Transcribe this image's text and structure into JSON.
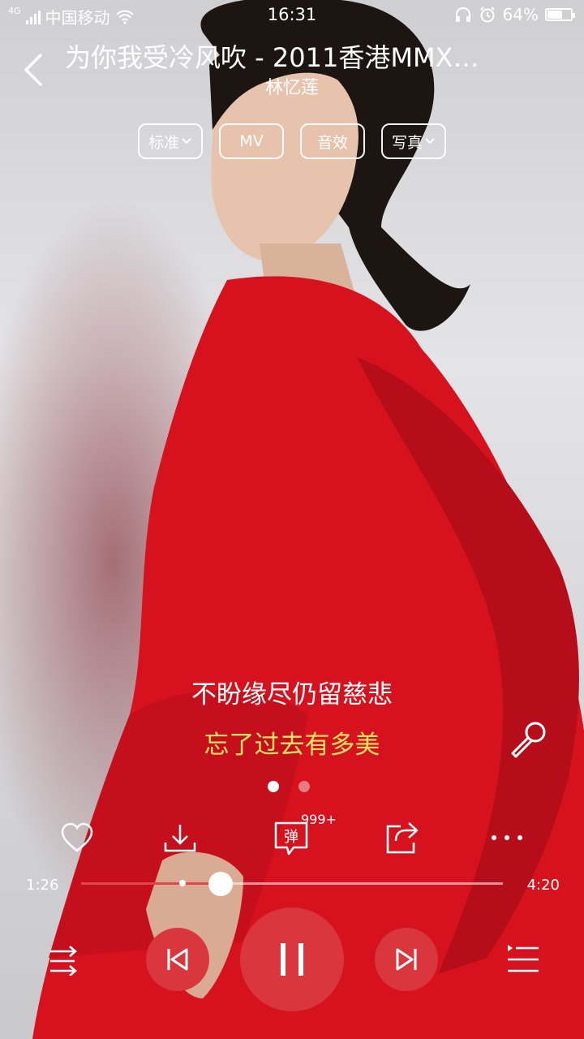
{
  "status_bar": {
    "network": "4G",
    "carrier": "中国移动",
    "time": "16:31",
    "battery_text": "64%",
    "battery_level": 0.64
  },
  "header": {
    "title": "为你我受冷风吹 - 2011香港MMX…",
    "artist": "林忆莲"
  },
  "pills": [
    {
      "label": "标准",
      "dropdown": true
    },
    {
      "label": "MV",
      "dropdown": false
    },
    {
      "label": "音效",
      "dropdown": false
    },
    {
      "label": "写真",
      "dropdown": true
    }
  ],
  "lyrics": {
    "previous_line": "不盼缘尽仍留慈悲",
    "current_line": "忘了过去有多美"
  },
  "pager": {
    "count": 2,
    "active_index": 0
  },
  "actions": {
    "danmu_label": "弹",
    "danmu_count": "999+"
  },
  "progress": {
    "current": "1:26",
    "total": "4:20",
    "played_fraction": 0.33,
    "buffer_fraction": 0.24
  },
  "colors": {
    "accent": "#d9363e",
    "played_track": "#e0474c",
    "lyric_current": "#f5e463",
    "lyric_previous": "#ffffff"
  },
  "icons": {
    "back": "chevron-left-icon",
    "mic": "microphone-icon",
    "like": "heart-icon",
    "download": "download-icon",
    "danmu": "danmu-bubble-icon",
    "share": "share-icon",
    "more": "more-dots-icon",
    "shuffle": "shuffle-icon",
    "prev": "skip-previous-icon",
    "pause": "pause-icon",
    "next": "skip-next-icon",
    "playlist": "playlist-icon"
  }
}
